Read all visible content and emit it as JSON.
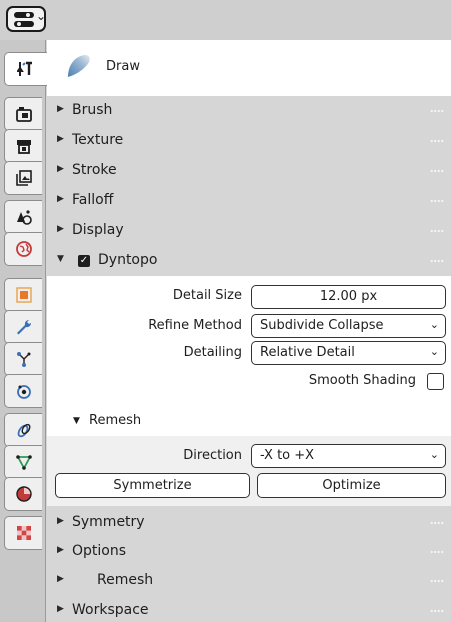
{
  "header": {
    "editor_type_icon": "properties-editor-icon"
  },
  "tabs": [
    {
      "name": "tool",
      "icon": "tool-settings-icon",
      "active": true
    },
    {
      "name": "render",
      "icon": "render-icon"
    },
    {
      "name": "output",
      "icon": "output-icon"
    },
    {
      "name": "view-layer",
      "icon": "view-layer-icon"
    },
    {
      "name": "scene",
      "icon": "scene-icon"
    },
    {
      "name": "world",
      "icon": "world-icon"
    },
    {
      "name": "object",
      "icon": "object-icon"
    },
    {
      "name": "modifiers",
      "icon": "wrench-icon"
    },
    {
      "name": "particles",
      "icon": "particles-icon"
    },
    {
      "name": "physics",
      "icon": "physics-icon"
    },
    {
      "name": "constraints",
      "icon": "constraints-icon"
    },
    {
      "name": "data",
      "icon": "mesh-data-icon"
    },
    {
      "name": "material",
      "icon": "material-icon"
    },
    {
      "name": "texture",
      "icon": "texture-icon"
    }
  ],
  "brush": {
    "name": "Draw"
  },
  "panels": {
    "brush": "Brush",
    "texture": "Texture",
    "stroke": "Stroke",
    "falloff": "Falloff",
    "display": "Display",
    "dyntopo": "Dyntopo",
    "symmetry": "Symmetry",
    "options": "Options",
    "remesh": "Remesh",
    "workspace": "Workspace"
  },
  "dyntopo": {
    "enabled": true,
    "detail_size_label": "Detail Size",
    "detail_size_value": "12.00 px",
    "refine_method_label": "Refine Method",
    "refine_method_value": "Subdivide Collapse",
    "detailing_label": "Detailing",
    "detailing_value": "Relative Detail",
    "smooth_shading_label": "Smooth Shading",
    "smooth_shading": false,
    "remesh_sub_label": "Remesh",
    "direction_label": "Direction",
    "direction_value": "-X to +X",
    "symmetrize_label": "Symmetrize",
    "optimize_label": "Optimize"
  },
  "colors": {
    "background": "#d6d6d6",
    "panel_body": "#ffffff",
    "tab_column": "#c8c8c8"
  }
}
